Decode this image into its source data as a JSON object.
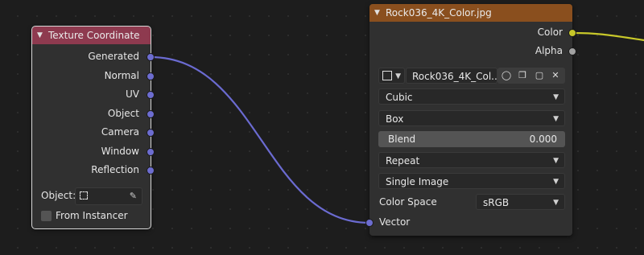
{
  "texture_coordinate_node": {
    "title": "Texture Coordinate",
    "header_color": "#8e3a4f",
    "outputs": [
      "Generated",
      "Normal",
      "UV",
      "Object",
      "Camera",
      "Window",
      "Reflection"
    ],
    "socket_color": "#6d6dd0",
    "object_label": "Object:",
    "from_instancer_label": "From Instancer"
  },
  "image_texture_node": {
    "title": "Rock036_4K_Color.jpg",
    "header_color": "#8a4f1e",
    "outputs": {
      "color": "Color",
      "alpha": "Alpha"
    },
    "color_socket_color": "#c7c729",
    "alpha_socket_color": "#a1a1a1",
    "image_name": "Rock036_4K_Col...",
    "interpolation": "Cubic",
    "projection": "Box",
    "blend_label": "Blend",
    "blend_value": "0.000",
    "extension": "Repeat",
    "source": "Single Image",
    "color_space_label": "Color Space",
    "color_space": "sRGB",
    "vector_input": "Vector",
    "vector_socket_color": "#6d6dd0"
  },
  "links": {
    "vector_link_color": "#6b6bd1",
    "color_link_color": "#c8c82a"
  }
}
